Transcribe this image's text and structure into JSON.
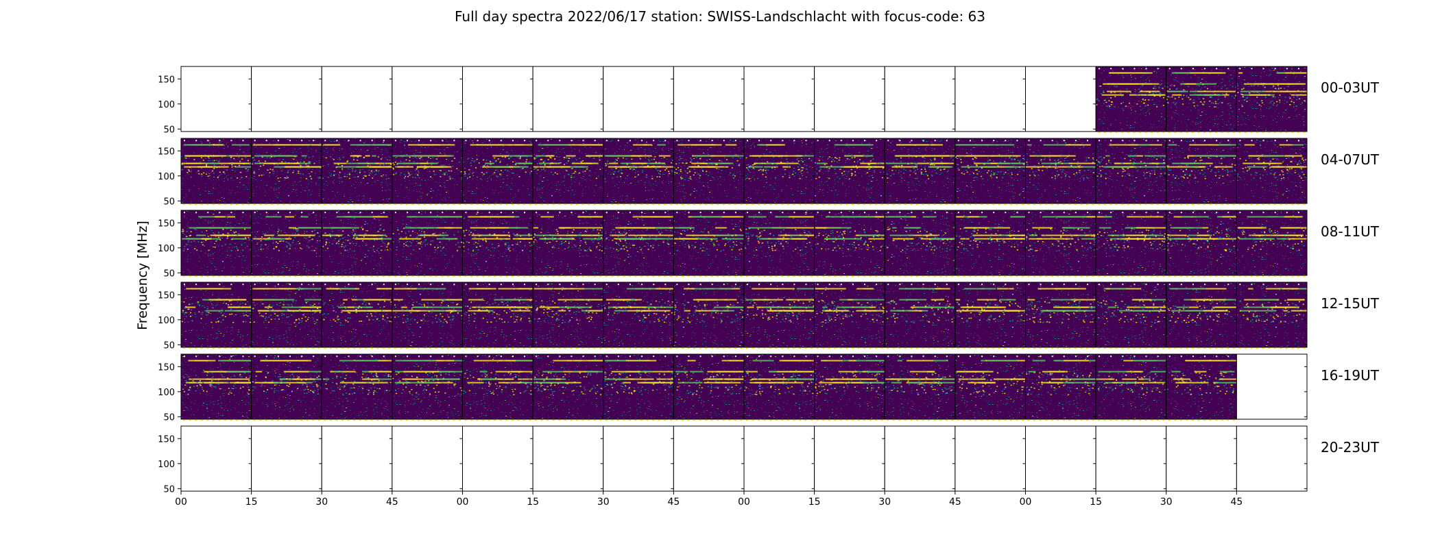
{
  "chart_data": {
    "type": "heatmap",
    "title": "Full day spectra 2022/06/17 station: SWISS-Landschlacht with focus-code: 63",
    "ylabel": "Frequency [MHz]",
    "xlabel": "",
    "ylim": [
      45,
      175
    ],
    "y_ticks": [
      "150",
      "100",
      "50"
    ],
    "y_tick_values": [
      150,
      100,
      50
    ],
    "x_tick_labels": [
      "00",
      "15",
      "30",
      "45",
      "00",
      "15",
      "30",
      "45",
      "00",
      "15",
      "30",
      "45",
      "00",
      "15",
      "30",
      "45"
    ],
    "panels_per_row": 16,
    "panel_minutes": 15,
    "colormap": "viridis",
    "colors": {
      "low": "#440154",
      "mid_low": "#3b528b",
      "mid": "#21918c",
      "mid_high": "#5ec962",
      "high": "#fde725"
    },
    "rows": [
      {
        "label": "00-03UT",
        "data_panels": [
          13,
          14,
          15
        ]
      },
      {
        "label": "04-07UT",
        "data_panels": [
          0,
          1,
          2,
          3,
          4,
          5,
          6,
          7,
          8,
          9,
          10,
          11,
          12,
          13,
          14,
          15
        ]
      },
      {
        "label": "08-11UT",
        "data_panels": [
          0,
          1,
          2,
          3,
          4,
          5,
          6,
          7,
          8,
          9,
          10,
          11,
          12,
          13,
          14,
          15
        ]
      },
      {
        "label": "12-15UT",
        "data_panels": [
          0,
          1,
          2,
          3,
          4,
          5,
          6,
          7,
          8,
          9,
          10,
          11,
          12,
          13,
          14,
          15
        ]
      },
      {
        "label": "16-19UT",
        "data_panels": [
          0,
          1,
          2,
          3,
          4,
          5,
          6,
          7,
          8,
          9,
          10,
          11,
          12,
          13,
          14
        ]
      },
      {
        "label": "20-23UT",
        "data_panels": []
      }
    ],
    "bright_bands_mhz": [
      162,
      140,
      125,
      118
    ],
    "grid": false
  }
}
